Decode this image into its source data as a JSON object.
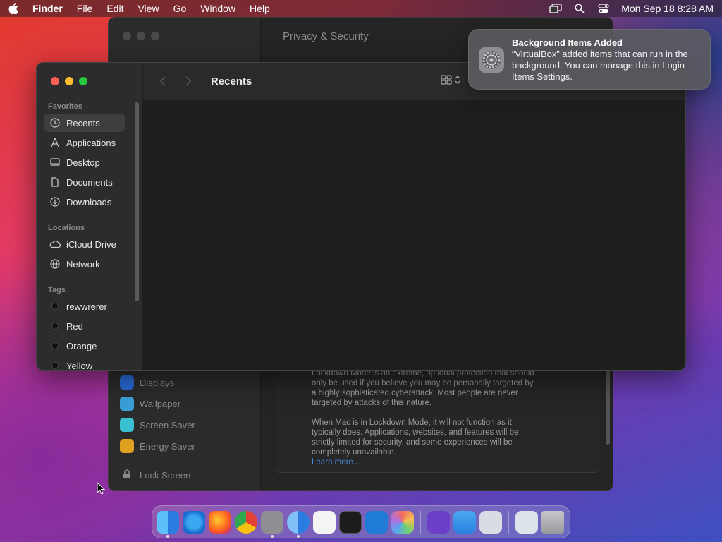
{
  "menubar": {
    "app_name": "Finder",
    "items": [
      "File",
      "Edit",
      "View",
      "Go",
      "Window",
      "Help"
    ],
    "clock": "Mon Sep 18  8:28 AM"
  },
  "settings_window": {
    "title": "Privacy & Security",
    "sidebar_items": [
      "Displays",
      "Wallpaper",
      "Screen Saver",
      "Energy Saver"
    ],
    "lock_screen": "Lock Screen",
    "lockdown_text_1": "Lockdown Mode is an extreme, optional protection that should only be used if you believe you may be personally targeted by a highly sophisticated cyberattack. Most people are never targeted by attacks of this nature.",
    "lockdown_text_2": "When Mac is in Lockdown Mode, it will not function as it typically does. Applications, websites, and features will be strictly limited for security, and some experiences will be completely unavailable.",
    "learn_more": "Learn more..."
  },
  "finder": {
    "title": "Recents",
    "sidebar": {
      "favorites_header": "Favorites",
      "favorites": [
        "Recents",
        "Applications",
        "Desktop",
        "Documents",
        "Downloads"
      ],
      "locations_header": "Locations",
      "locations": [
        "iCloud Drive",
        "Network"
      ],
      "tags_header": "Tags",
      "tags": [
        "rewwrerer",
        "Red",
        "Orange",
        "Yellow"
      ]
    }
  },
  "notification": {
    "title": "Background Items Added",
    "body": "“VirtualBox” added items that can run in the background. You can manage this in Login Items Settings."
  },
  "dock": {
    "apps": [
      "Finder",
      "Safari",
      "Firefox",
      "Chrome",
      "System Settings",
      "Chrome Canary",
      "TextEdit",
      "Terminal",
      "VS Code",
      "Launchpad",
      "Visual Studio",
      "iCloud",
      "Preview",
      "Downloads",
      "Trash"
    ]
  }
}
